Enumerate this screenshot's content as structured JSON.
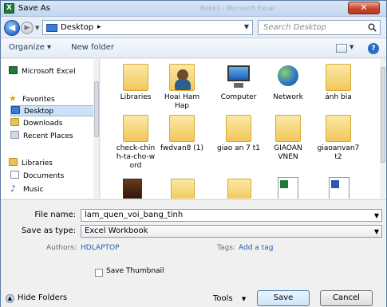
{
  "window": {
    "title": "Save As",
    "ghost_title": "Book1 - Microsoft Excel"
  },
  "address": {
    "location": "Desktop",
    "search_placeholder": "Search Desktop"
  },
  "toolbar": {
    "organize": "Organize ▾",
    "new_folder": "New folder"
  },
  "nav": {
    "app": "Microsoft Excel",
    "favorites": "Favorites",
    "desktop": "Desktop",
    "downloads": "Downloads",
    "recent": "Recent Places",
    "libraries": "Libraries",
    "documents": "Documents",
    "music": "Music"
  },
  "items": [
    {
      "label": "Libraries",
      "icon": "libraries-icon"
    },
    {
      "label": "Hoai Ham Hap",
      "icon": "user-folder-icon"
    },
    {
      "label": "Computer",
      "icon": "computer-icon"
    },
    {
      "label": "Network",
      "icon": "network-icon"
    },
    {
      "label": "ảnh bìa",
      "icon": "folder-icon"
    },
    {
      "label": "check-chin h-ta-cho-w ord",
      "icon": "folder-icon"
    },
    {
      "label": "fwdvan8 (1)",
      "icon": "folder-icon"
    },
    {
      "label": "giao an 7 t1",
      "icon": "folder-icon"
    },
    {
      "label": "GIAOAN VNEN",
      "icon": "folder-icon"
    },
    {
      "label": "giaoanvan7 t2",
      "icon": "folder-icon"
    }
  ],
  "form": {
    "file_name_label": "File name:",
    "file_name": "lam_quen_voi_bang_tinh",
    "save_type_label": "Save as type:",
    "save_type": "Excel Workbook",
    "authors_label": "Authors:",
    "authors": "HDLAPTOP",
    "tags_label": "Tags:",
    "tags": "Add a tag",
    "thumbnail": "Save Thumbnail"
  },
  "footer": {
    "hide_folders": "Hide Folders",
    "tools": "Tools",
    "save": "Save",
    "cancel": "Cancel"
  }
}
